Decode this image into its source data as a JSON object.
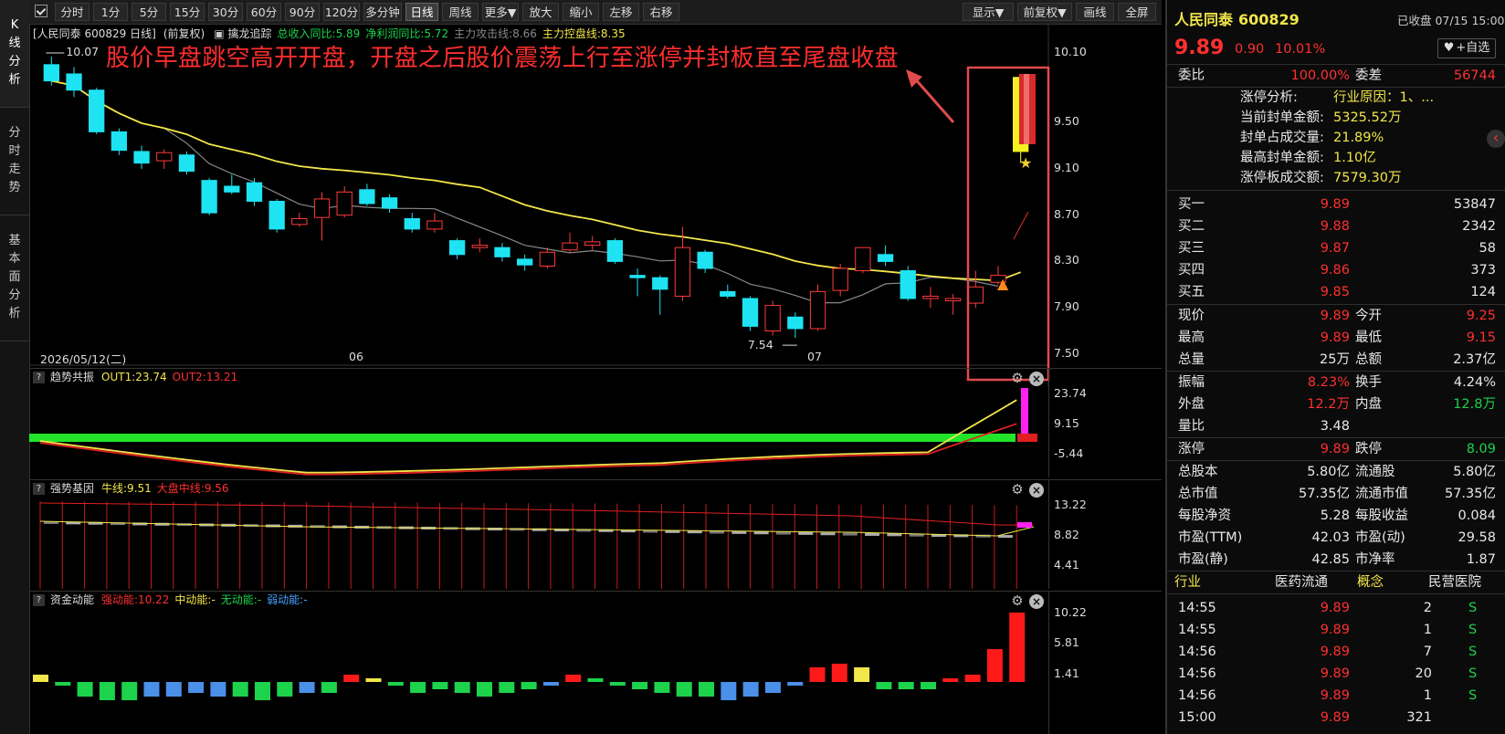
{
  "sidebar": {
    "tabs": [
      {
        "label": "K线分析",
        "chars": [
          "K",
          "线",
          "分",
          "析"
        ]
      },
      {
        "label": "分时走势",
        "chars": [
          "分",
          "时",
          "走",
          "势"
        ]
      },
      {
        "label": "基本面分析",
        "chars": [
          "基",
          "本",
          "面",
          "分",
          "析"
        ]
      }
    ]
  },
  "toolbar": {
    "left_buttons": [
      "分时",
      "1分",
      "5分",
      "15分",
      "30分",
      "60分",
      "90分",
      "120分",
      "多分钟",
      "日线",
      "周线",
      "更多▼",
      "放大",
      "缩小",
      "左移",
      "右移"
    ],
    "active": "日线",
    "right_buttons": [
      "显示▼",
      "前复权▼",
      "画线",
      "全屏"
    ]
  },
  "main_chart": {
    "header_title": "[人民同泰 600829 日线]",
    "header_adjust": "(前复权)",
    "tracker_label": "擒龙追踪",
    "stats": [
      {
        "text": "总收入同比:5.89",
        "color": "#1cd34b"
      },
      {
        "text": "净利润同比:5.72",
        "color": "#1cd34b"
      },
      {
        "text": "主力攻击线:8.66",
        "color": "#888888"
      },
      {
        "text": "主力控盘线:8.35",
        "color": "#f2e64a"
      }
    ],
    "annotation": "股价早盘跳空高开开盘，开盘之后股价震荡上行至涨停并封板直至尾盘收盘",
    "high_mark": "10.07",
    "low_mark": "7.54",
    "y_ticks": [
      "10.10",
      "9.50",
      "9.10",
      "8.70",
      "8.30",
      "7.90",
      "7.50"
    ],
    "x_labels": [
      "2026/05/12(二)",
      "06",
      "07"
    ]
  },
  "chart_data": {
    "type": "candlestick",
    "y_range": [
      7.42,
      10.18
    ],
    "y_ticks": [
      10.1,
      9.5,
      9.1,
      8.7,
      8.3,
      7.9,
      7.5
    ],
    "candles": [
      [
        10.0,
        9.86,
        10.07,
        9.82
      ],
      [
        9.92,
        9.78,
        9.98,
        9.72
      ],
      [
        9.78,
        9.42,
        9.8,
        9.4
      ],
      [
        9.42,
        9.26,
        9.45,
        9.22
      ],
      [
        9.25,
        9.15,
        9.3,
        9.1
      ],
      [
        9.17,
        9.24,
        9.27,
        9.1
      ],
      [
        9.22,
        9.08,
        9.25,
        9.05
      ],
      [
        9.0,
        8.72,
        9.02,
        8.7
      ],
      [
        8.95,
        8.9,
        9.05,
        8.88
      ],
      [
        8.98,
        8.82,
        9.02,
        8.78
      ],
      [
        8.82,
        8.58,
        8.84,
        8.55
      ],
      [
        8.62,
        8.67,
        8.72,
        8.6
      ],
      [
        8.68,
        8.84,
        8.9,
        8.48
      ],
      [
        8.7,
        8.9,
        8.95,
        8.68
      ],
      [
        8.92,
        8.8,
        8.97,
        8.78
      ],
      [
        8.85,
        8.76,
        8.88,
        8.72
      ],
      [
        8.67,
        8.58,
        8.72,
        8.55
      ],
      [
        8.58,
        8.65,
        8.72,
        8.55
      ],
      [
        8.48,
        8.36,
        8.5,
        8.32
      ],
      [
        8.42,
        8.44,
        8.5,
        8.38
      ],
      [
        8.42,
        8.34,
        8.46,
        8.3
      ],
      [
        8.32,
        8.27,
        8.36,
        8.22
      ],
      [
        8.26,
        8.38,
        8.42,
        8.24
      ],
      [
        8.4,
        8.46,
        8.55,
        8.38
      ],
      [
        8.44,
        8.47,
        8.52,
        8.4
      ],
      [
        8.48,
        8.3,
        8.5,
        8.28
      ],
      [
        8.18,
        8.16,
        8.24,
        8.0
      ],
      [
        8.16,
        8.06,
        8.18,
        7.84
      ],
      [
        8.0,
        8.42,
        8.6,
        7.96
      ],
      [
        8.38,
        8.24,
        8.4,
        8.2
      ],
      [
        8.04,
        8.0,
        8.1,
        7.98
      ],
      [
        7.98,
        7.74,
        8.0,
        7.7
      ],
      [
        7.7,
        7.92,
        7.96,
        7.66
      ],
      [
        7.82,
        7.72,
        7.86,
        7.64
      ],
      [
        7.72,
        8.04,
        8.1,
        7.7
      ],
      [
        8.05,
        8.24,
        8.28,
        8.0
      ],
      [
        8.22,
        8.42,
        8.42,
        8.2
      ],
      [
        8.36,
        8.3,
        8.44,
        8.26
      ],
      [
        8.22,
        7.98,
        8.26,
        7.96
      ],
      [
        7.98,
        8.0,
        8.08,
        7.9
      ],
      [
        7.96,
        7.98,
        8.02,
        7.84
      ],
      [
        7.94,
        8.08,
        8.22,
        7.9
      ],
      [
        8.12,
        8.18,
        8.26,
        8.1
      ],
      [
        9.25,
        9.89,
        9.89,
        9.15
      ]
    ],
    "lines": [
      {
        "name": "主力控盘线",
        "color": "#f2e64a",
        "last": 8.35
      },
      {
        "name": "主力攻击线",
        "color": "#888888",
        "last": 8.66
      }
    ]
  },
  "indicators": [
    {
      "key": "trend",
      "title": "趋势共振",
      "params": [
        {
          "text": "OUT1:23.74",
          "color": "#f2e64a"
        },
        {
          "text": "OUT2:13.21",
          "color": "#ff3030"
        }
      ],
      "y_ticks": [
        "23.74",
        "9.15",
        "-5.44"
      ]
    },
    {
      "key": "gene",
      "title": "强势基因",
      "params": [
        {
          "text": "牛线:9.51",
          "color": "#f2e64a"
        },
        {
          "text": "大盘中线:9.56",
          "color": "#ff3030"
        }
      ],
      "y_ticks": [
        "13.22",
        "8.82",
        "4.41"
      ]
    },
    {
      "key": "fund",
      "title": "资金动能",
      "params": [
        {
          "text": "强动能:10.22",
          "color": "#ff3030"
        },
        {
          "text": "中动能:-",
          "color": "#f2e64a"
        },
        {
          "text": "无动能:-",
          "color": "#1cd34b"
        },
        {
          "text": "弱动能:-",
          "color": "#4aa3ff"
        }
      ],
      "y_ticks": [
        "10.22",
        "5.81",
        "1.41"
      ]
    }
  ],
  "info": {
    "name": "人民同泰",
    "code": "600829",
    "status": "已收盘 07/15 15:00",
    "price": "9.89",
    "change": "0.90",
    "change_pct": "10.01%",
    "add_fav": "+自选",
    "weibi_label": "委比",
    "weibi": "100.00%",
    "weicha_label": "委差",
    "weicha": "56744",
    "limit_analysis": [
      {
        "label": "涨停分析:",
        "value": "行业原因：1、..."
      },
      {
        "label": "当前封单金额:",
        "value": "5325.52万"
      },
      {
        "label": "封单占成交量:",
        "value": "21.89%"
      },
      {
        "label": "最高封单金额:",
        "value": "1.10亿"
      },
      {
        "label": "涨停板成交额:",
        "value": "7579.30万"
      }
    ],
    "bids": [
      {
        "label": "买一",
        "price": "9.89",
        "vol": "53847"
      },
      {
        "label": "买二",
        "price": "9.88",
        "vol": "2342"
      },
      {
        "label": "买三",
        "price": "9.87",
        "vol": "58"
      },
      {
        "label": "买四",
        "price": "9.86",
        "vol": "373"
      },
      {
        "label": "买五",
        "price": "9.85",
        "vol": "124"
      }
    ],
    "quote_rows": [
      [
        {
          "t": "现价",
          "c": "white"
        },
        {
          "t": "9.89",
          "c": "red"
        },
        {
          "t": "今开",
          "c": "white"
        },
        {
          "t": "9.25",
          "c": "red"
        }
      ],
      [
        {
          "t": "最高",
          "c": "white"
        },
        {
          "t": "9.89",
          "c": "red"
        },
        {
          "t": "最低",
          "c": "white"
        },
        {
          "t": "9.15",
          "c": "red"
        }
      ],
      [
        {
          "t": "总量",
          "c": "white"
        },
        {
          "t": "25万",
          "c": "white"
        },
        {
          "t": "总额",
          "c": "white"
        },
        {
          "t": "2.37亿",
          "c": "white"
        }
      ]
    ],
    "amp_rows": [
      [
        {
          "t": "振幅",
          "c": "white"
        },
        {
          "t": "8.23%",
          "c": "red"
        },
        {
          "t": "换手",
          "c": "white"
        },
        {
          "t": "4.24%",
          "c": "white"
        }
      ],
      [
        {
          "t": "外盘",
          "c": "white"
        },
        {
          "t": "12.2万",
          "c": "red"
        },
        {
          "t": "内盘",
          "c": "white"
        },
        {
          "t": "12.8万",
          "c": "green"
        }
      ],
      [
        {
          "t": "量比",
          "c": "white"
        },
        {
          "t": "3.48",
          "c": "white"
        },
        {
          "t": "",
          "c": "white"
        },
        {
          "t": "",
          "c": "white"
        }
      ]
    ],
    "limit_rows": [
      [
        {
          "t": "涨停",
          "c": "white"
        },
        {
          "t": "9.89",
          "c": "red"
        },
        {
          "t": "跌停",
          "c": "white"
        },
        {
          "t": "8.09",
          "c": "green"
        }
      ]
    ],
    "fund_rows": [
      [
        {
          "t": "总股本",
          "c": "white"
        },
        {
          "t": "5.80亿",
          "c": "white"
        },
        {
          "t": "流通股",
          "c": "white"
        },
        {
          "t": "5.80亿",
          "c": "white"
        }
      ],
      [
        {
          "t": "总市值",
          "c": "white"
        },
        {
          "t": "57.35亿",
          "c": "white"
        },
        {
          "t": "流通市值",
          "c": "white"
        },
        {
          "t": "57.35亿",
          "c": "white"
        }
      ],
      [
        {
          "t": "每股净资",
          "c": "white"
        },
        {
          "t": "5.28",
          "c": "white"
        },
        {
          "t": "每股收益",
          "c": "white"
        },
        {
          "t": "0.084",
          "c": "white"
        }
      ],
      [
        {
          "t": "市盈(TTM)",
          "c": "white"
        },
        {
          "t": "42.03",
          "c": "white"
        },
        {
          "t": "市盈(动)",
          "c": "white"
        },
        {
          "t": "29.58",
          "c": "white"
        }
      ],
      [
        {
          "t": "市盈(静)",
          "c": "white"
        },
        {
          "t": "42.85",
          "c": "white"
        },
        {
          "t": "市净率",
          "c": "white"
        },
        {
          "t": "1.87",
          "c": "white"
        }
      ]
    ],
    "industry": [
      {
        "t": "行业",
        "c": "yellow"
      },
      {
        "t": "医药流通",
        "c": "white"
      },
      {
        "t": "概念",
        "c": "yellow"
      },
      {
        "t": "民营医院",
        "c": "white"
      }
    ],
    "trades": [
      {
        "time": "14:55",
        "price": "9.89",
        "vol": "2",
        "side": "S"
      },
      {
        "time": "14:55",
        "price": "9.89",
        "vol": "1",
        "side": "S"
      },
      {
        "time": "14:56",
        "price": "9.89",
        "vol": "7",
        "side": "S"
      },
      {
        "time": "14:56",
        "price": "9.89",
        "vol": "20",
        "side": "S"
      },
      {
        "time": "14:56",
        "price": "9.89",
        "vol": "1",
        "side": "S"
      },
      {
        "time": "15:00",
        "price": "9.89",
        "vol": "321",
        "side": ""
      }
    ]
  }
}
